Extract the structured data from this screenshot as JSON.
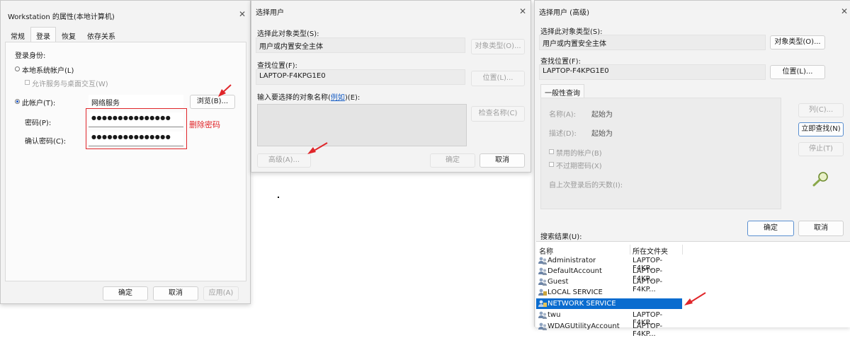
{
  "win1": {
    "title": "Workstation 的属性(本地计算机)",
    "tabs": [
      "常规",
      "登录",
      "恢复",
      "依存关系"
    ],
    "logon_as_label": "登录身份:",
    "local_system_label": "本地系统帐户(L)",
    "allow_desktop_label": "允许服务与桌面交互(W)",
    "this_account_label": "此帐户(T):",
    "this_account_value": "网络服务",
    "browse_button": "浏览(B)...",
    "password_label": "密码(P):",
    "password_value": "●●●●●●●●●●●●●●●",
    "confirm_label": "确认密码(C):",
    "confirm_value": "●●●●●●●●●●●●●●●",
    "annotation": "删除密码",
    "ok": "确定",
    "cancel": "取消",
    "apply": "应用(A)"
  },
  "win2": {
    "title": "选择用户",
    "object_type_label": "选择此对象类型(S):",
    "object_type_value": "用户或内置安全主体",
    "object_types_button": "对象类型(O)...",
    "location_label": "查找位置(F):",
    "location_value": "LAPTOP-F4KPG1E0",
    "location_button": "位置(L)...",
    "enter_names_prefix": "输入要选择的对象名称(",
    "examples_link": "例如",
    "enter_names_suffix": ")(E):",
    "check_names_button": "检查名称(C)",
    "advanced_button": "高级(A)...",
    "ok": "确定",
    "cancel": "取消"
  },
  "win3": {
    "title": "选择用户 (高级)",
    "object_type_label": "选择此对象类型(S):",
    "object_type_value": "用户或内置安全主体",
    "object_types_button": "对象类型(O)...",
    "location_label": "查找位置(F):",
    "location_value": "LAPTOP-F4KPG1E0",
    "location_button": "位置(L)...",
    "common_queries_tab": "一般性查询",
    "name_label": "名称(A):",
    "name_mode": "起始为",
    "desc_label": "描述(D):",
    "desc_mode": "起始为",
    "disabled_label": "禁用的帐户(B)",
    "nonexpiring_label": "不过期密码(X)",
    "days_label": "自上次登录后的天数(I):",
    "columns_button": "列(C)...",
    "find_now_button": "立即查找(N)",
    "stop_button": "停止(T)",
    "ok": "确定",
    "cancel": "取消",
    "results_label": "搜索结果(U):",
    "col_name": "名称",
    "col_folder": "所在文件夹",
    "results": [
      {
        "name": "Administrator",
        "folder": "LAPTOP-F4KP..."
      },
      {
        "name": "DefaultAccount",
        "folder": "LAPTOP-F4KP..."
      },
      {
        "name": "Guest",
        "folder": "LAPTOP-F4KP..."
      },
      {
        "name": "LOCAL SERVICE",
        "folder": ""
      },
      {
        "name": "NETWORK SERVICE",
        "folder": ""
      },
      {
        "name": "twu",
        "folder": "LAPTOP-F4KP..."
      },
      {
        "name": "WDAGUtilityAccount",
        "folder": "LAPTOP-F4KP..."
      }
    ]
  },
  "colors": {
    "annotation_red": "#e0262a",
    "selection_blue": "#0a6ccf",
    "link_blue": "#1a5fc4"
  }
}
